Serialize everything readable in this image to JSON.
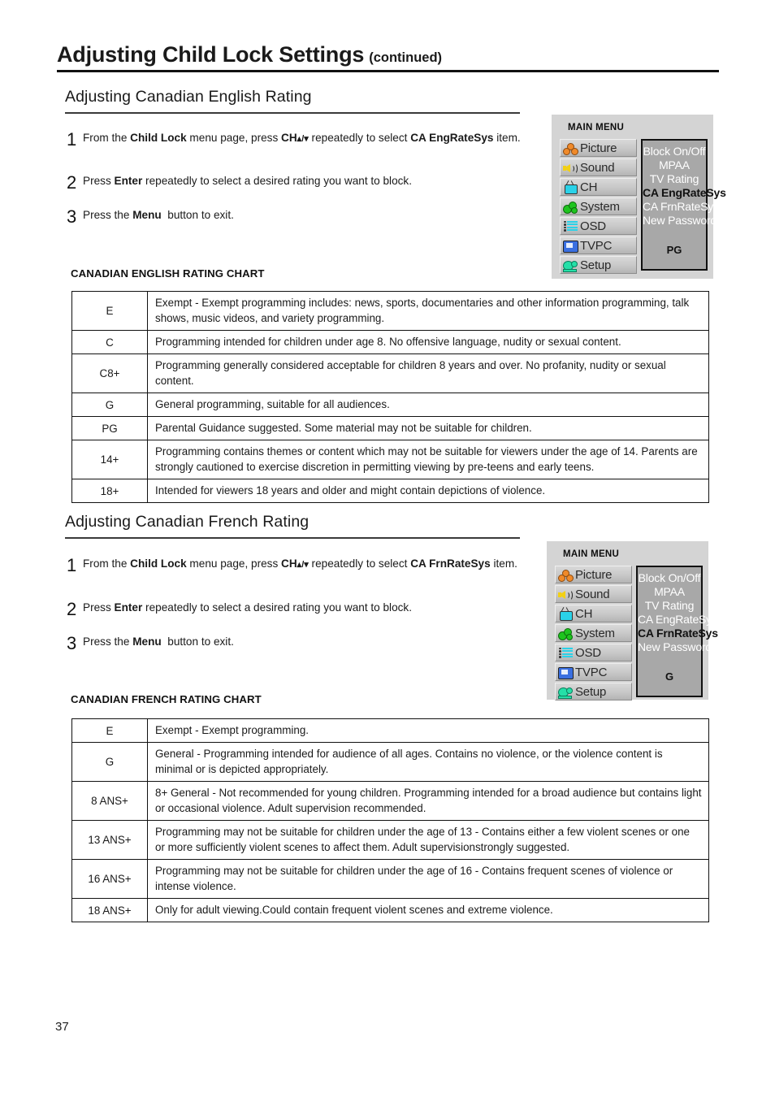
{
  "header": {
    "title": "Adjusting Child Lock Settings",
    "continued": "(continued)"
  },
  "page_number": "37",
  "sections": [
    {
      "heading": "Adjusting Canadian English Rating",
      "steps": [
        {
          "number": "1",
          "parts": [
            {
              "text": "From the ",
              "bold": false
            },
            {
              "text": "Child Lock",
              "bold": true
            },
            {
              "text": " menu page, press ",
              "bold": false
            },
            {
              "text": "CH",
              "bold": true
            },
            {
              "text": "▴/▾",
              "bold": true
            },
            {
              "text": " repeatedly to select ",
              "bold": false
            },
            {
              "text": "CA EngRateSys",
              "bold": true
            },
            {
              "text": " item.",
              "bold": false
            }
          ]
        },
        {
          "number": "2",
          "parts": [
            {
              "text": "Press ",
              "bold": false
            },
            {
              "text": "Enter",
              "bold": true
            },
            {
              "text": " repeatedly to select a desired rating you want to block.",
              "bold": false
            }
          ]
        },
        {
          "number": "3",
          "parts": [
            {
              "text": "Press the ",
              "bold": false
            },
            {
              "text": "Menu",
              "bold": true
            },
            {
              "text": "  button to exit.",
              "bold": false
            }
          ]
        }
      ],
      "osd": {
        "main_menu_label": "MAIN MENU",
        "items": [
          {
            "label": "Picture",
            "icon": "picture-icon"
          },
          {
            "label": "Sound",
            "icon": "speaker-icon"
          },
          {
            "label": "CH",
            "icon": "tv-antenna-icon"
          },
          {
            "label": "System",
            "icon": "gears-icon"
          },
          {
            "label": "OSD",
            "icon": "list-lines-icon"
          },
          {
            "label": "TVPC",
            "icon": "monitor-icon"
          },
          {
            "label": "Setup",
            "icon": "tools-icon"
          }
        ],
        "submenu": [
          {
            "label": "Block On/Off",
            "selected": false
          },
          {
            "label": "MPAA",
            "selected": false
          },
          {
            "label": "TV Rating",
            "selected": false
          },
          {
            "label": "CA EngRateSys",
            "selected": true
          },
          {
            "label": "CA FrnRateSys",
            "selected": false
          },
          {
            "label": "New Password",
            "selected": false
          }
        ],
        "value": "PG"
      },
      "chart_caption": "CANADIAN ENGLISH RATING CHART",
      "chart_rows": [
        {
          "code": "E",
          "desc": "Exempt - Exempt programming includes: news, sports, documentaries and other information programming, talk shows, music videos, and variety programming."
        },
        {
          "code": "C",
          "desc": "Programming intended for children under age 8. No offensive language, nudity or sexual content."
        },
        {
          "code": "C8+",
          "desc": "Programming generally considered acceptable for children 8 years and over. No profanity, nudity or sexual content."
        },
        {
          "code": "G",
          "desc": "General programming, suitable for all audiences."
        },
        {
          "code": "PG",
          "desc": "Parental Guidance suggested. Some material may not be suitable for children."
        },
        {
          "code": "14+",
          "desc": "Programming contains themes or content which may not be suitable for viewers under the age of 14. Parents are strongly cautioned to exercise discretion in permitting viewing by pre-teens and early teens."
        },
        {
          "code": "18+",
          "desc": "Intended for viewers 18 years and older and might contain depictions of violence."
        }
      ]
    },
    {
      "heading": "Adjusting Canadian French Rating",
      "steps": [
        {
          "number": "1",
          "parts": [
            {
              "text": "From the ",
              "bold": false
            },
            {
              "text": "Child Lock",
              "bold": true
            },
            {
              "text": " menu page, press ",
              "bold": false
            },
            {
              "text": "CH",
              "bold": true
            },
            {
              "text": "▴/▾",
              "bold": true
            },
            {
              "text": " repeatedly to select ",
              "bold": false
            },
            {
              "text": "CA FrnRateSys",
              "bold": true
            },
            {
              "text": " item.",
              "bold": false
            }
          ]
        },
        {
          "number": "2",
          "parts": [
            {
              "text": "Press ",
              "bold": false
            },
            {
              "text": "Enter",
              "bold": true
            },
            {
              "text": " repeatedly to select a desired rating you want to block.",
              "bold": false
            }
          ]
        },
        {
          "number": "3",
          "parts": [
            {
              "text": "Press the ",
              "bold": false
            },
            {
              "text": "Menu",
              "bold": true
            },
            {
              "text": "  button to exit.",
              "bold": false
            }
          ]
        }
      ],
      "osd": {
        "main_menu_label": "MAIN MENU",
        "items": [
          {
            "label": "Picture",
            "icon": "picture-icon"
          },
          {
            "label": "Sound",
            "icon": "speaker-icon"
          },
          {
            "label": "CH",
            "icon": "tv-antenna-icon"
          },
          {
            "label": "System",
            "icon": "gears-icon"
          },
          {
            "label": "OSD",
            "icon": "list-lines-icon"
          },
          {
            "label": "TVPC",
            "icon": "monitor-icon"
          },
          {
            "label": "Setup",
            "icon": "tools-icon"
          }
        ],
        "submenu": [
          {
            "label": "Block On/Off",
            "selected": false
          },
          {
            "label": "MPAA",
            "selected": false
          },
          {
            "label": "TV Rating",
            "selected": false
          },
          {
            "label": "CA EngRateSys",
            "selected": false
          },
          {
            "label": "CA FrnRateSys",
            "selected": true
          },
          {
            "label": "New Password",
            "selected": false
          }
        ],
        "value": "G"
      },
      "chart_caption": "CANADIAN FRENCH RATING CHART",
      "chart_rows": [
        {
          "code": "E",
          "desc": "Exempt - Exempt programming."
        },
        {
          "code": "G",
          "desc": "General - Programming intended for audience of all ages. Contains no violence, or the violence content is minimal or is depicted appropriately."
        },
        {
          "code": "8 ANS+",
          "desc": "8+ General - Not recommended for young children. Programming intended for a broad audience but contains light or occasional violence. Adult supervision recommended."
        },
        {
          "code": "13 ANS+",
          "desc": "Programming may not be suitable for children under the age of 13 - Contains either a few violent scenes or one or more sufficiently violent scenes to affect them. Adult supervisionstrongly suggested."
        },
        {
          "code": "16 ANS+",
          "desc": "Programming may not be suitable for children under the age of 16 - Contains frequent scenes of violence or intense violence."
        },
        {
          "code": "18 ANS+",
          "desc": "Only for adult viewing.Could contain frequent violent scenes and extreme violence."
        }
      ]
    }
  ]
}
